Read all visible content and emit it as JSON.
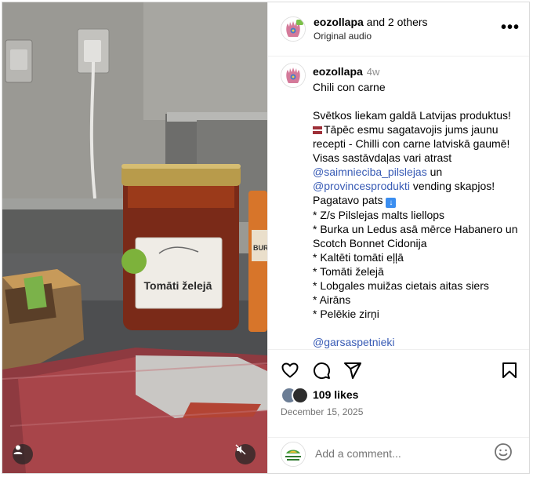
{
  "header": {
    "username": "eozollapa",
    "collab_suffix": " and 2 others",
    "audio": "Original audio",
    "more_label": "•••"
  },
  "caption": {
    "username": "eozollapa",
    "age": "4w",
    "lines": [
      "Chili con carne",
      "",
      "Svētkos liekam galdā Latvijas produktus!",
      "Tāpēc esmu sagatavojis jums jaunu",
      "recepti - Chilli con carne latviskā gaumē!",
      "Visas sastāvdaļas vari atrast",
      "@saimnieciba_pilslejas",
      " un",
      "@provincesprodukti",
      " vending skapjos!",
      "Pagatavo pats ",
      "* Z/s Pilslejas malts liellops",
      "* Burka un Ledus asā mērce Habanero un",
      "Scotch Bonnet Cidonija",
      "* Kaltēti tomāti eļļā",
      "* Tomāti želejā",
      "* Lobgales muižas cietais aitas siers",
      "* Airāns",
      "* Pelēkie zirņi",
      "",
      "@garsaspetnieki"
    ]
  },
  "media": {
    "jar_label": "Tomāti želejā",
    "bottle_label": "BUR"
  },
  "engagement": {
    "likes": "109 likes",
    "date": "December 15, 2025"
  },
  "comment": {
    "placeholder": "Add a comment..."
  },
  "colors": {
    "link": "#385bb5",
    "muted": "#737373"
  }
}
